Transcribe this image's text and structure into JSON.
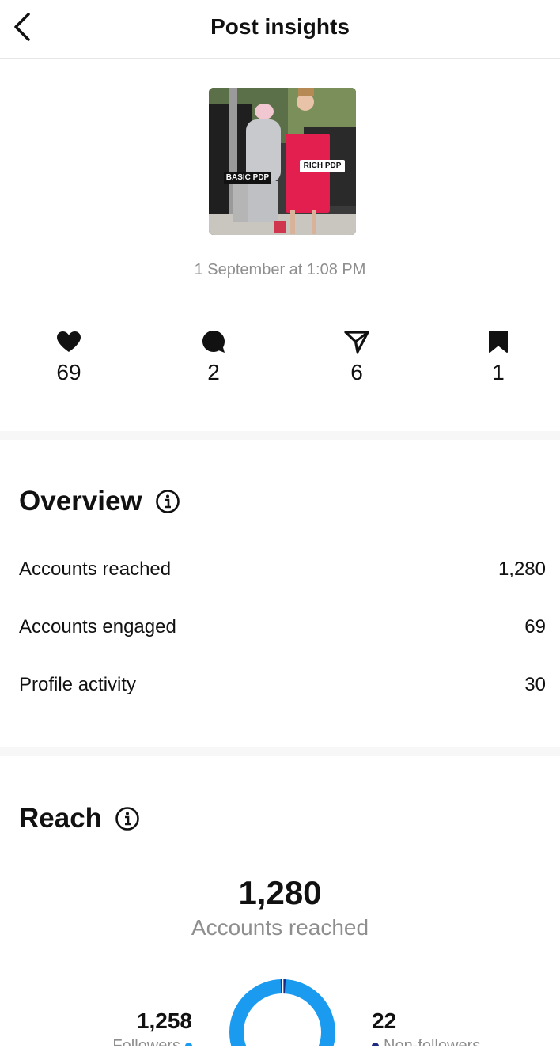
{
  "header": {
    "title": "Post insights"
  },
  "post": {
    "date": "1 September at 1:08 PM",
    "tags": [
      "BASIC PDP",
      "RICH PDP"
    ]
  },
  "stats": {
    "likes": "69",
    "comments": "2",
    "shares": "6",
    "saves": "1"
  },
  "overview": {
    "title": "Overview",
    "rows": [
      {
        "label": "Accounts reached",
        "value": "1,280"
      },
      {
        "label": "Accounts engaged",
        "value": "69"
      },
      {
        "label": "Profile activity",
        "value": "30"
      }
    ]
  },
  "reach": {
    "title": "Reach",
    "total": "1,280",
    "total_label": "Accounts reached",
    "followers": {
      "value": "1,258",
      "label": "Followers"
    },
    "non_followers": {
      "value": "22",
      "label": "Non-followers"
    }
  },
  "colors": {
    "followers": "#1a9bf0",
    "non_followers": "#1c2a80",
    "muted_text": "#8e8e8e"
  },
  "icons": [
    "back-chevron-icon",
    "heart-icon",
    "comment-icon",
    "share-icon",
    "bookmark-icon",
    "info-icon"
  ]
}
